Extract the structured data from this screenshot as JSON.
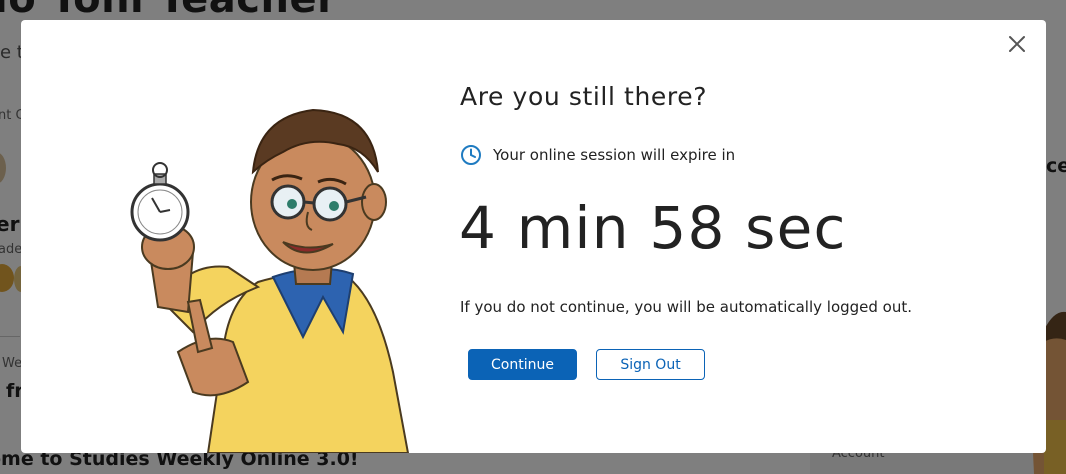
{
  "background": {
    "page_title": "lo Toni Teacher",
    "subtitle": "e t",
    "side_text": "nt C",
    "name": "er T",
    "grade": "ade",
    "we": "We",
    "fr": "fr",
    "welcome": "ome to Studies Weekly Online 3.0!",
    "ces": "ces",
    "account": "Account"
  },
  "modal": {
    "close_icon": "close-icon",
    "illustration": "teacher-with-stopwatch",
    "title": "Are you still there?",
    "session_icon": "clock-icon",
    "session_text": "Your online session will expire in",
    "countdown": "4 min 58 sec",
    "logout_message": "If you do not continue, you will be automatically logged out.",
    "continue_label": "Continue",
    "signout_label": "Sign Out"
  },
  "colors": {
    "accent": "#0b63b6",
    "overlay": "rgba(0,0,0,0.5)",
    "clock": "#1f7bc1"
  }
}
